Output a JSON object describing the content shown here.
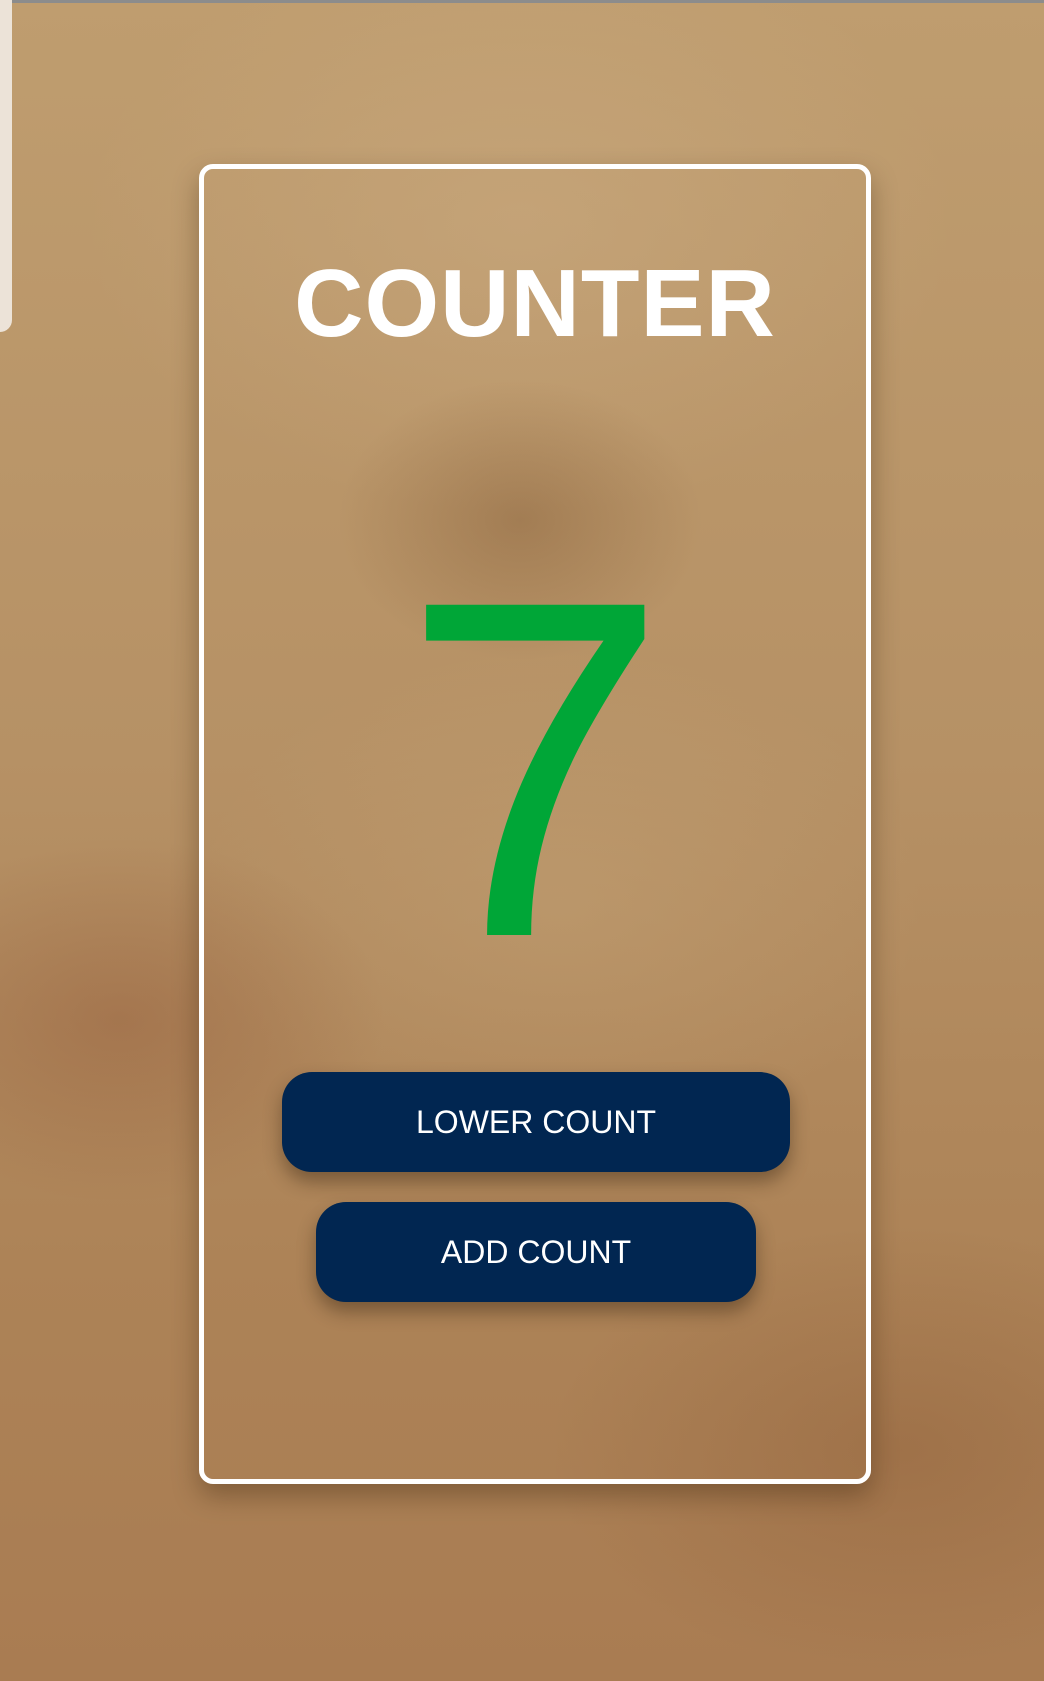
{
  "counter": {
    "title": "COUNTER",
    "value": "7",
    "value_color": "#00a637"
  },
  "buttons": {
    "lower_label": "LOWER COUNT",
    "add_label": "ADD COUNT",
    "color": "#012651"
  }
}
